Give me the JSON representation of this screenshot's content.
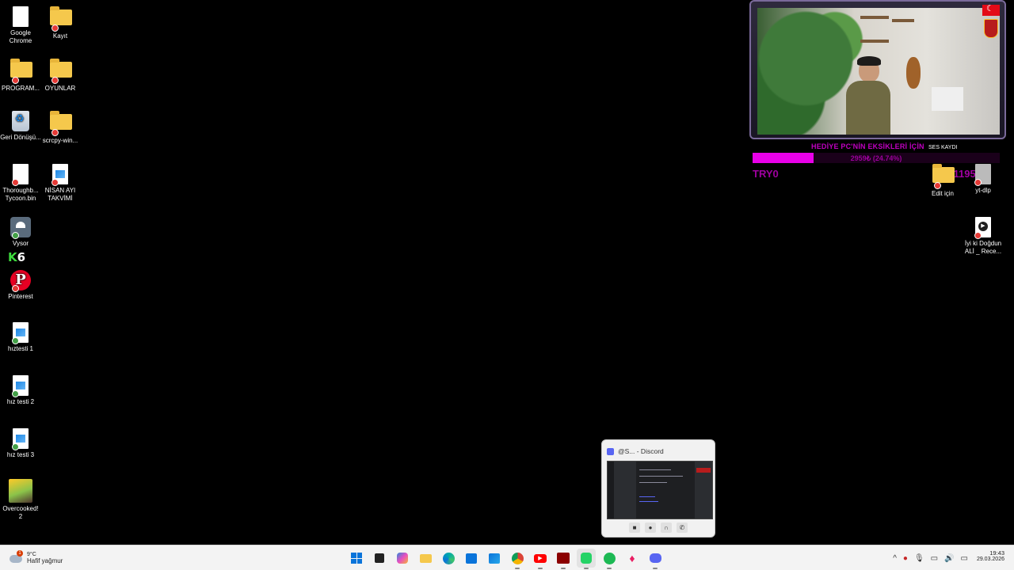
{
  "desktop": {
    "icons_left": [
      {
        "label": "Google Chrome"
      },
      {
        "label": "Kayıt"
      },
      {
        "label": "PROGRAM..."
      },
      {
        "label": "OYUNLAR"
      },
      {
        "label": "Geri Dönüşü..."
      },
      {
        "label": "scrcpy-win..."
      },
      {
        "label": "Thoroughb... Tycoon.bin"
      },
      {
        "label": "NİSAN AYI TAKVİMİ"
      },
      {
        "label": "Vysor"
      },
      {
        "label": "Pinterest"
      },
      {
        "label": "hıztesti 1"
      },
      {
        "label": "hız testi 2"
      },
      {
        "label": "hız testi 3"
      },
      {
        "label": "Overcooked! 2"
      }
    ],
    "k6_label": "6",
    "icons_right": [
      {
        "label": "Edit için"
      },
      {
        "label": "yt-dlp"
      },
      {
        "label": "İyi ki Doğdun ALİ _ Rece..."
      }
    ]
  },
  "stream_overlay": {
    "goal_title": "HEDİYE PC'NİN EKSİKLERİ İÇİN",
    "goal_progress_text": "2959₺ (24.74%)",
    "goal_progress_percent": 24.74,
    "ses_kaydi": "SES KAYDI",
    "try_left": "TRY0",
    "try_right": "TRY11959"
  },
  "discord_popup": {
    "title": "@S... - Discord",
    "controls": [
      "camera-icon",
      "mic-icon",
      "headphones-icon",
      "hangup-icon"
    ]
  },
  "taskbar": {
    "weather_temp": "9°C",
    "weather_desc": "Hafif yağmur",
    "weather_alert_count": "1",
    "apps": [
      "start",
      "task-view",
      "copilot",
      "file-explorer",
      "edge",
      "store",
      "outlook",
      "chrome",
      "youtube",
      "obs-stream",
      "whatsapp",
      "spotify",
      "app-red",
      "discord"
    ],
    "time": "19:43",
    "date": "29.03.2026"
  },
  "colors": {
    "goal_fill": "#e800e8",
    "goal_text": "#9a009a",
    "taskbar_bg": "#f3f3f3",
    "discord": "#5865f2"
  }
}
